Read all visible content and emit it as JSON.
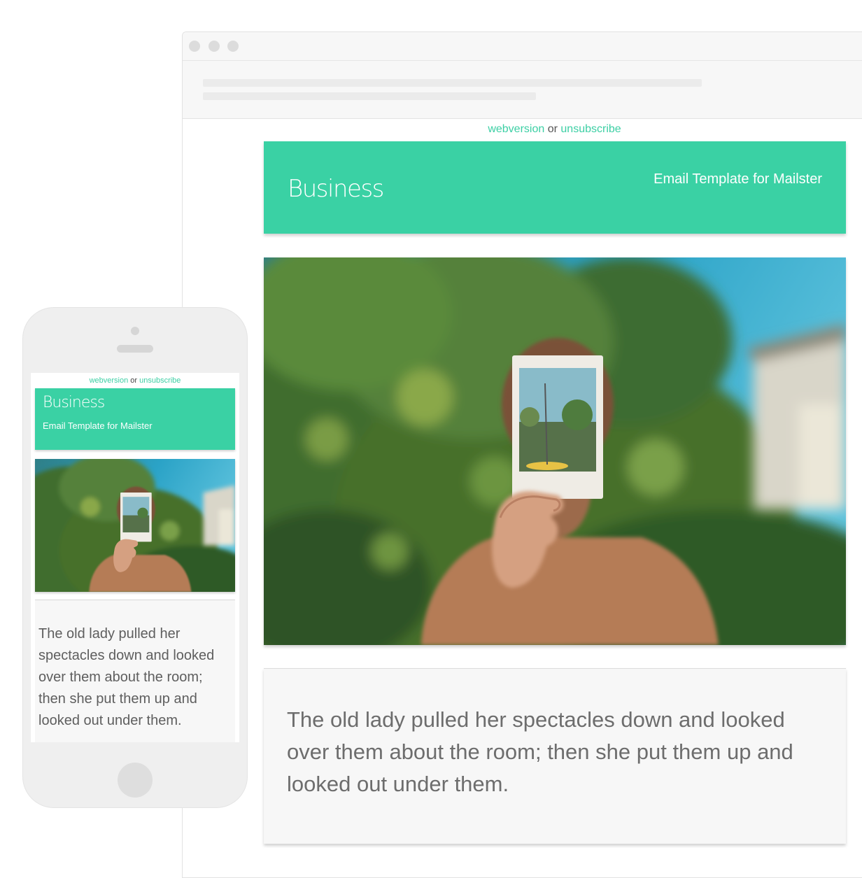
{
  "email": {
    "links": {
      "webversion": "webversion",
      "separator": "or",
      "unsubscribe": "unsubscribe"
    },
    "brand": "Business",
    "tagline": "Email Template for Mailster",
    "body_text": "The old lady pulled her spectacles down and looked over them about the room; then she put them up and looked out under them."
  },
  "colors": {
    "accent": "#3ad1a4",
    "link": "#3ccfa4",
    "body_text": "#6d6d6d",
    "card_bg": "#f7f7f7"
  },
  "images": {
    "hero_photo": "man-holding-instant-photo-in-front-of-face",
    "mobile_hero_photo": "man-holding-instant-photo-in-front-of-face"
  }
}
